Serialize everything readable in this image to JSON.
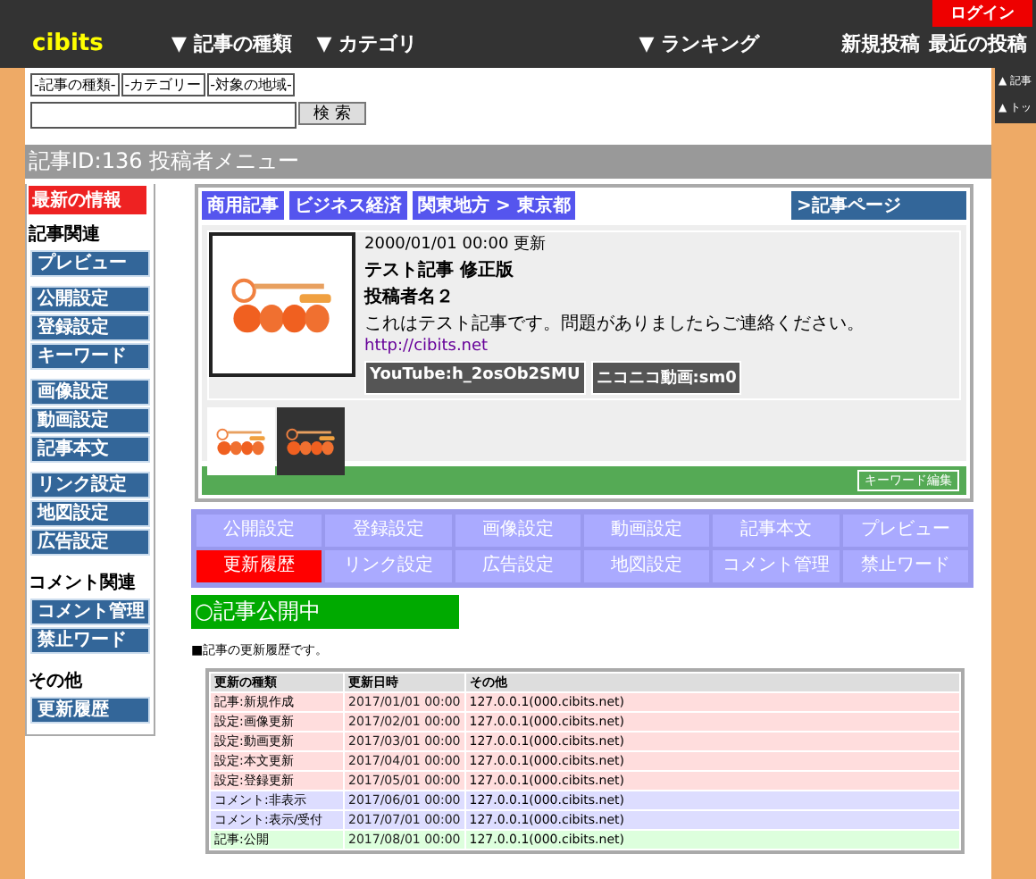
{
  "header": {
    "logo": "cibits",
    "login": "ログイン",
    "nav": [
      "▼ 記事の種類",
      "▼ カテゴリ",
      "▼ ランキング"
    ],
    "links": [
      "新規投稿",
      "最近の投稿"
    ]
  },
  "side_links": [
    "▲ 記事",
    "▲ トッ"
  ],
  "search": {
    "selects": [
      "-記事の種類-",
      "-カテゴリー",
      "-対象の地域-"
    ],
    "button": "検 索"
  },
  "page_title": "記事ID:136  投稿者メニュー",
  "sidebar": [
    {
      "kind": "highlight",
      "label": "最新の情報"
    },
    {
      "kind": "heading",
      "label": "記事関連"
    },
    {
      "kind": "group",
      "links": [
        "プレビュー"
      ]
    },
    {
      "kind": "group",
      "links": [
        "公開設定",
        "登録設定",
        "キーワード"
      ]
    },
    {
      "kind": "group",
      "links": [
        "画像設定",
        "動画設定",
        "記事本文"
      ]
    },
    {
      "kind": "group",
      "links": [
        "リンク設定",
        "地図設定",
        "広告設定"
      ]
    },
    {
      "kind": "heading",
      "label": "コメント関連"
    },
    {
      "kind": "group",
      "links": [
        "コメント管理",
        "禁止ワード"
      ]
    },
    {
      "kind": "heading",
      "label": "その他"
    },
    {
      "kind": "group",
      "links": [
        "更新履歴"
      ]
    }
  ],
  "article": {
    "tags": [
      "商用記事",
      "ビジネス経済",
      "関東地方 > 東京都"
    ],
    "page_link": ">記事ページ",
    "updated": "2000/01/01 00:00 更新",
    "title": "テスト記事 修正版",
    "author": "投稿者名２",
    "body": "これはテスト記事です。問題がありましたらご連絡ください。",
    "url": "http://cibits.net",
    "videos": [
      "YouTube:h_2osOb2SMU",
      "ニコニコ動画:sm0"
    ],
    "keyword_button": "キーワード編集"
  },
  "tabs": [
    {
      "label": "公開設定",
      "selected": false
    },
    {
      "label": "登録設定",
      "selected": false
    },
    {
      "label": "画像設定",
      "selected": false
    },
    {
      "label": "動画設定",
      "selected": false
    },
    {
      "label": "記事本文",
      "selected": false
    },
    {
      "label": "プレビュー",
      "selected": false
    },
    {
      "label": "更新履歴",
      "selected": true
    },
    {
      "label": "リンク設定",
      "selected": false
    },
    {
      "label": "広告設定",
      "selected": false
    },
    {
      "label": "地図設定",
      "selected": false
    },
    {
      "label": "コメント管理",
      "selected": false
    },
    {
      "label": "禁止ワード",
      "selected": false
    }
  ],
  "status": "○記事公開中",
  "note": "■記事の更新履歴です。",
  "table": {
    "columns": [
      "更新の種類",
      "更新日時",
      "その他"
    ],
    "rows": [
      {
        "cells": [
          "記事:新規作成",
          "2017/01/01 00:00",
          "127.0.0.1(000.cibits.net)"
        ],
        "color": "#ffdddd"
      },
      {
        "cells": [
          "設定:画像更新",
          "2017/02/01 00:00",
          "127.0.0.1(000.cibits.net)"
        ],
        "color": "#ffdddd"
      },
      {
        "cells": [
          "設定:動画更新",
          "2017/03/01 00:00",
          "127.0.0.1(000.cibits.net)"
        ],
        "color": "#ffdddd"
      },
      {
        "cells": [
          "設定:本文更新",
          "2017/04/01 00:00",
          "127.0.0.1(000.cibits.net)"
        ],
        "color": "#ffdddd"
      },
      {
        "cells": [
          "設定:登録更新",
          "2017/05/01 00:00",
          "127.0.0.1(000.cibits.net)"
        ],
        "color": "#ffdddd"
      },
      {
        "cells": [
          "コメント:非表示",
          "2017/06/01 00:00",
          "127.0.0.1(000.cibits.net)"
        ],
        "color": "#ddddff"
      },
      {
        "cells": [
          "コメント:表示/受付",
          "2017/07/01 00:00",
          "127.0.0.1(000.cibits.net)"
        ],
        "color": "#ddddff"
      },
      {
        "cells": [
          "記事:公開",
          "2017/08/01 00:00",
          "127.0.0.1(000.cibits.net)"
        ],
        "color": "#ddffdd"
      }
    ]
  }
}
